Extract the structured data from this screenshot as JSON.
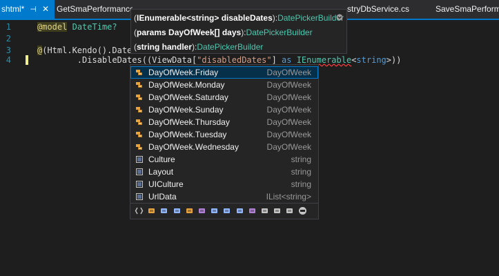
{
  "tabs": [
    {
      "label": "shtml*",
      "active": true,
      "pin": "⊣",
      "close": "✕"
    },
    {
      "label": "GetSmaPerformance"
    },
    {
      "label": "stryDbService.cs"
    },
    {
      "label": "SaveSmaPerformar"
    }
  ],
  "editor": {
    "line_numbers": [
      "1",
      "2",
      "3",
      "4"
    ],
    "line1": {
      "directive": "@model",
      "type": "DateTime?"
    },
    "line3": {
      "at": "@",
      "text": "(Html.Kendo().Date"
    },
    "line4": {
      "pre": "        .DisableDates((ViewData[",
      "string": "\"disabledDates\"",
      "mid": "] ",
      "as_kw": "as",
      "space": " ",
      "ienum": "IEnumerable",
      "lt": "<",
      "strkw": "string",
      "end": ">))"
    }
  },
  "signature_help": {
    "rows": [
      {
        "open": "(",
        "bold": "IEnumerable<string> disableDates",
        "close": "):",
        "ret": "DatePickerBuilder"
      },
      {
        "open": "(",
        "bold": "params DayOfWeek[] days",
        "close": "):",
        "ret": "DatePickerBuilder"
      },
      {
        "open": "(",
        "bold": "string handler",
        "close": "):",
        "ret": "DatePickerBuilder"
      }
    ],
    "scroll_icon": "chevron-down-icon"
  },
  "completion": {
    "items": [
      {
        "label": "DayOfWeek.Friday",
        "type": "DayOfWeek",
        "icon": "enum-member-icon"
      },
      {
        "label": "DayOfWeek.Monday",
        "type": "DayOfWeek",
        "icon": "enum-member-icon"
      },
      {
        "label": "DayOfWeek.Saturday",
        "type": "DayOfWeek",
        "icon": "enum-member-icon"
      },
      {
        "label": "DayOfWeek.Sunday",
        "type": "DayOfWeek",
        "icon": "enum-member-icon"
      },
      {
        "label": "DayOfWeek.Thursday",
        "type": "DayOfWeek",
        "icon": "enum-member-icon"
      },
      {
        "label": "DayOfWeek.Tuesday",
        "type": "DayOfWeek",
        "icon": "enum-member-icon"
      },
      {
        "label": "DayOfWeek.Wednesday",
        "type": "DayOfWeek",
        "icon": "enum-member-icon"
      },
      {
        "label": "Culture",
        "type": "string",
        "icon": "property-icon"
      },
      {
        "label": "Layout",
        "type": "string",
        "icon": "property-icon"
      },
      {
        "label": "UICulture",
        "type": "string",
        "icon": "property-icon"
      },
      {
        "label": "UrlData",
        "type": "IList<string>",
        "icon": "property-icon"
      }
    ],
    "selected_index": 0,
    "filters": [
      "namespace-filter-icon",
      "class-filter-icon",
      "interface-filter-icon",
      "struct-filter-icon",
      "enum-filter-icon",
      "delegate-filter-icon",
      "module-filter-icon",
      "field-filter-icon",
      "property-filter-icon",
      "method-filter-icon",
      "event-filter-icon",
      "extension-filter-icon",
      "keyword-filter-icon",
      "snippet-filter-icon"
    ]
  },
  "colors": {
    "accent": "#007acc",
    "enum": "#e8a33d",
    "property": "#8fb6ff",
    "type": "#4ec9b0"
  }
}
